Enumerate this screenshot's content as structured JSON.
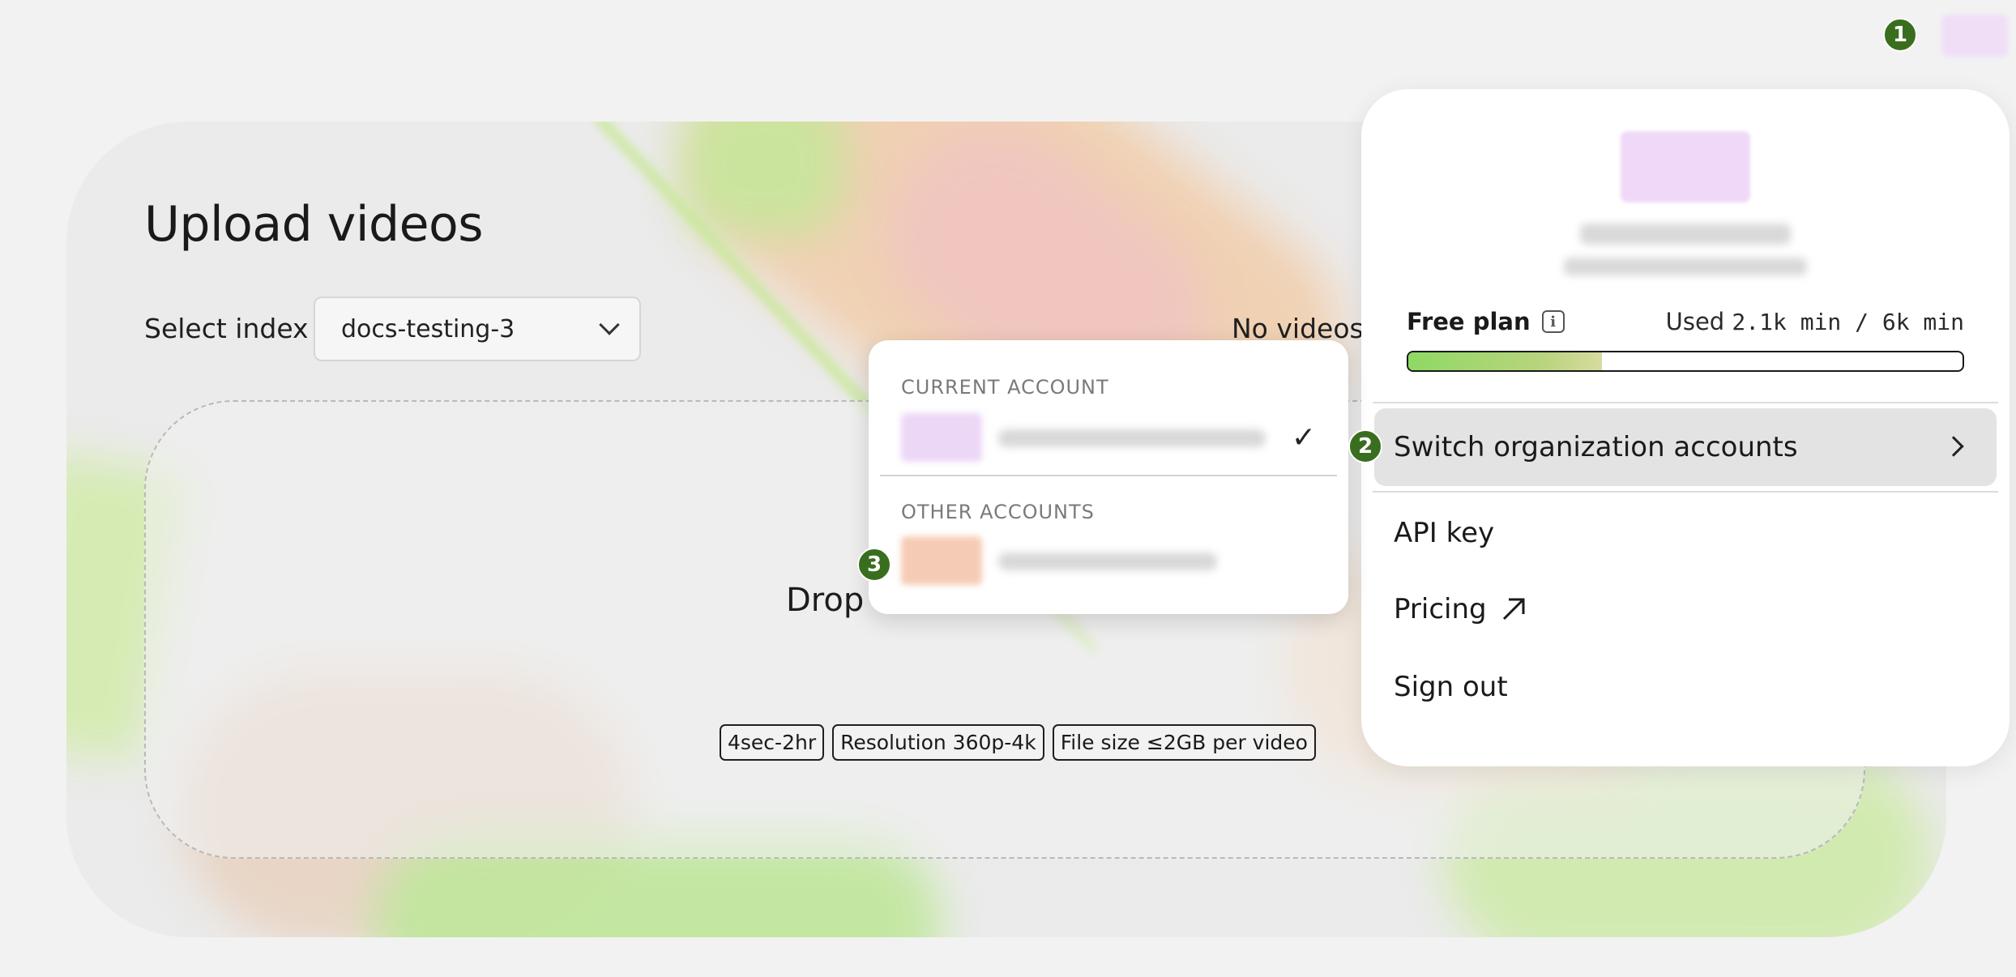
{
  "main": {
    "title": "Upload videos",
    "select_index_label": "Select index",
    "selected_index": "docs-testing-3",
    "no_videos_text": "No videos",
    "drop_text": "Drop",
    "chips": [
      "4sec-2hr",
      "Resolution 360p-4k",
      "File size ≤2GB per video"
    ]
  },
  "account_menu": {
    "plan_label": "Free plan",
    "usage_prefix": "Used",
    "usage_value": "2.1k min / 6k min",
    "usage_fraction": 0.35,
    "switch_label": "Switch organization accounts",
    "api_key_label": "API key",
    "pricing_label": "Pricing",
    "sign_out_label": "Sign out"
  },
  "submenu": {
    "current_heading": "CURRENT ACCOUNT",
    "other_heading": "OTHER ACCOUNTS"
  },
  "steps": [
    "1",
    "2",
    "3"
  ],
  "colors": {
    "step_badge": "#3a6e1f",
    "progress_start": "#8fd964",
    "switch_row_bg": "#e3e3e3"
  }
}
